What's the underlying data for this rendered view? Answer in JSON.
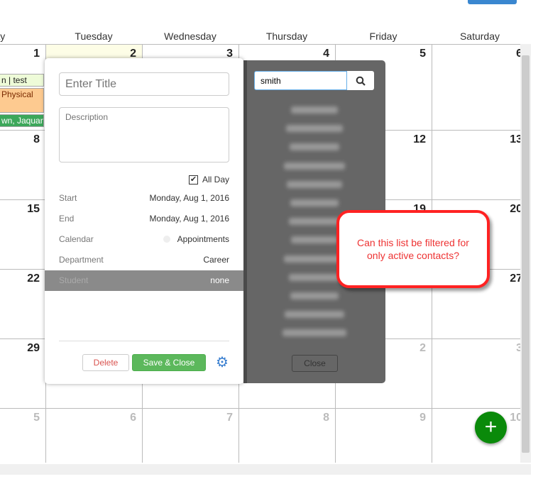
{
  "calendar": {
    "days": [
      "day",
      "Tuesday",
      "Wednesday",
      "Thursday",
      "Friday",
      "Saturday"
    ],
    "weeks": [
      [
        {
          "n": "1"
        },
        {
          "n": "2"
        },
        {
          "n": "3"
        },
        {
          "n": "4"
        },
        {
          "n": "5"
        },
        {
          "n": "6"
        }
      ],
      [
        {
          "n": "8"
        },
        {
          "n": ""
        },
        {
          "n": ""
        },
        {
          "n": ""
        },
        {
          "n": "12"
        },
        {
          "n": "13"
        }
      ],
      [
        {
          "n": "15"
        },
        {
          "n": ""
        },
        {
          "n": ""
        },
        {
          "n": ""
        },
        {
          "n": "19"
        },
        {
          "n": "20"
        }
      ],
      [
        {
          "n": "22"
        },
        {
          "n": ""
        },
        {
          "n": ""
        },
        {
          "n": ""
        },
        {
          "n": ""
        },
        {
          "n": "27"
        }
      ],
      [
        {
          "n": "29"
        },
        {
          "n": ""
        },
        {
          "n": ""
        },
        {
          "n": ""
        },
        {
          "n": "2",
          "grey": true
        },
        {
          "n": "3",
          "grey": true
        }
      ],
      [
        {
          "n": "5",
          "grey": true
        },
        {
          "n": "6",
          "grey": true
        },
        {
          "n": "7",
          "grey": true
        },
        {
          "n": "8",
          "grey": true
        },
        {
          "n": "9",
          "grey": true
        },
        {
          "n": "10",
          "grey": true
        }
      ]
    ],
    "events": [
      {
        "label": "n | test",
        "color": "#eefbd8",
        "text": "#222"
      },
      {
        "label": "Physical",
        "color": "#fdca90",
        "text": "#7a2a00"
      },
      {
        "label": "wn, Jaquan",
        "color": "#3ca75a",
        "text": "#fff"
      }
    ]
  },
  "event_popup": {
    "title_placeholder": "Enter Title",
    "description_placeholder": "Description",
    "all_day_label": "All Day",
    "all_day_checked": true,
    "fields": [
      {
        "label": "Start",
        "value": "Monday, Aug 1, 2016"
      },
      {
        "label": "End",
        "value": "Monday, Aug 1, 2016"
      },
      {
        "label": "Calendar",
        "value": "Appointments"
      },
      {
        "label": "Department",
        "value": "Career"
      },
      {
        "label": "Student",
        "value": "none"
      }
    ],
    "delete_label": "Delete",
    "save_label": "Save & Close",
    "save_color": "#5cb85c"
  },
  "search_panel": {
    "query": "smith",
    "result_count_blurred": 13,
    "close_label": "Close"
  },
  "annotation": {
    "text": "Can this list be filtered for only active contacts?",
    "color": "#ff2a1a"
  },
  "fab": {
    "icon": "plus-icon",
    "label": "+",
    "color": "#0a8a0a"
  }
}
